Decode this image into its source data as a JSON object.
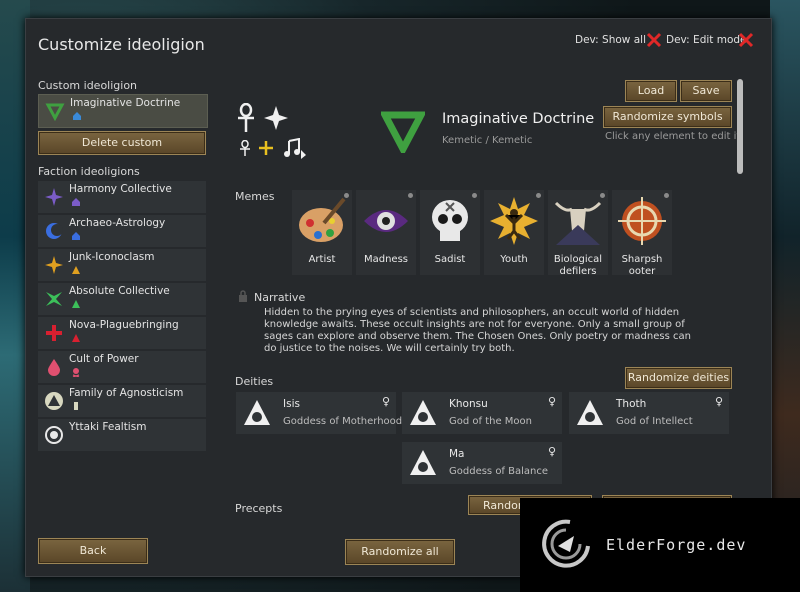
{
  "window": {
    "title": "Customize ideoligion",
    "dev_show_all": "Dev: Show all",
    "dev_edit_mode": "Dev: Edit mode"
  },
  "header": {
    "load": "Load",
    "save": "Save",
    "randomize_symbols": "Randomize symbols",
    "name": "Imaginative Doctrine",
    "adjective": "Kemetic / Kemetic",
    "hint": "Click any element to edit it"
  },
  "sidebar": {
    "custom_label": "Custom ideoligion",
    "custom_item": "Imaginative Doctrine",
    "delete_custom": "Delete custom",
    "faction_label": "Faction ideoligions",
    "factions": [
      {
        "name": "Harmony Collective",
        "icon": "star-burst-icon",
        "color": "#7b5cc8"
      },
      {
        "name": "Archaeo-Astrology",
        "icon": "crescent-moon-icon",
        "color": "#3a6ee0"
      },
      {
        "name": "Junk-Iconoclasm",
        "icon": "sun-star-icon",
        "color": "#e0a020"
      },
      {
        "name": "Absolute Collective",
        "icon": "claw-icon",
        "color": "#3cc05a"
      },
      {
        "name": "Nova-Plaguebringing",
        "icon": "cross-icon",
        "color": "#d82030"
      },
      {
        "name": "Cult of Power",
        "icon": "drop-icon",
        "color": "#e05070"
      },
      {
        "name": "Family of Agnosticism",
        "icon": "triangle-icon",
        "color": "#d8d8c0"
      },
      {
        "name": "Yttaki Fealtism",
        "icon": "circle-dot-icon",
        "color": "#e8e8e8"
      }
    ],
    "back": "Back"
  },
  "memes": {
    "label": "Memes",
    "items": [
      {
        "name": "Artist",
        "icon": "palette-icon"
      },
      {
        "name": "Madness",
        "icon": "eye-icon"
      },
      {
        "name": "Sadist",
        "icon": "skull-icon"
      },
      {
        "name": "Youth",
        "icon": "youth-icon"
      },
      {
        "name": "Biological defilers",
        "icon": "animal-skull-icon"
      },
      {
        "name": "Sharpshooter",
        "line1": "Sharpsh",
        "line2": "ooter",
        "icon": "crosshair-icon"
      }
    ]
  },
  "narrative": {
    "label": "Narrative",
    "text": "Hidden to the prying eyes of scientists and philosophers, an occult world of hidden knowledge awaits. These occult insights are not for everyone. Only a small group of sages can explore and observe them. The Chosen Ones. Only poetry or madness can do justice to the noises. We will certainly try both."
  },
  "deities": {
    "label": "Deities",
    "randomize": "Randomize deities",
    "items": [
      {
        "name": "Isis",
        "desc": "Goddess of Motherhood"
      },
      {
        "name": "Khonsu",
        "desc": "God of the Moon"
      },
      {
        "name": "Thoth",
        "desc": "God of Intellect"
      },
      {
        "name": "Ma",
        "desc": "Goddess of Balance"
      }
    ]
  },
  "precepts": {
    "label": "Precepts",
    "randomize": "Random"
  },
  "footer": {
    "randomize_all": "Randomize all"
  },
  "watermark": {
    "text": "ElderForge.dev"
  },
  "colors": {
    "ideo": "#3fa040",
    "button": "#6b5533"
  }
}
